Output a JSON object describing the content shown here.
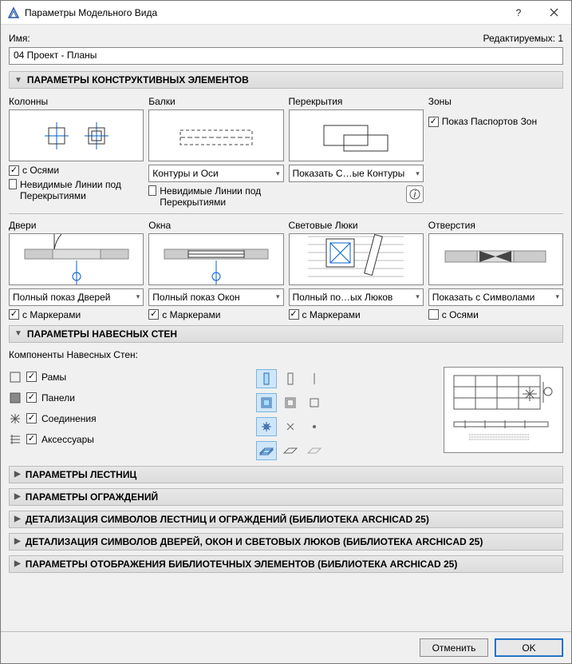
{
  "window": {
    "title": "Параметры Модельного Вида"
  },
  "header": {
    "name_label": "Имя:",
    "editable_label": "Редактируемых: 1",
    "name_value": "04 Проект - Планы"
  },
  "sections": {
    "construction": "ПАРАМЕТРЫ КОНСТРУКТИВНЫХ ЭЛЕМЕНТОВ",
    "curtain": "ПАРАМЕТРЫ НАВЕСНЫХ СТЕН",
    "stairs": "ПАРАМЕТРЫ ЛЕСТНИЦ",
    "railings": "ПАРАМЕТРЫ ОГРАЖДЕНИЙ",
    "detail_stairs": "ДЕТАЛИЗАЦИЯ СИМВОЛОВ ЛЕСТНИЦ И ОГРАЖДЕНИЙ (БИБЛИОТЕКА ARCHICAD 25)",
    "detail_doors": "ДЕТАЛИЗАЦИЯ СИМВОЛОВ ДВЕРЕЙ, ОКОН И СВЕТОВЫХ ЛЮКОВ (БИБЛИОТЕКА ARCHICAD 25)",
    "library": "ПАРАМЕТРЫ ОТОБРАЖЕНИЯ БИБЛИОТЕЧНЫХ ЭЛЕМЕНТОВ (БИБЛИОТЕКА ARCHICAD 25)"
  },
  "columns": {
    "label": "Колонны",
    "chk_axes": "с Осями",
    "chk_hidden": "Невидимые Линии под Перекрытиями"
  },
  "beams": {
    "label": "Балки",
    "select": "Контуры и Оси",
    "chk_hidden": "Невидимые Линии под Перекрытиями"
  },
  "slabs": {
    "label": "Перекрытия",
    "select": "Показать С…ые Контуры"
  },
  "zones": {
    "label": "Зоны",
    "chk": "Показ Паспортов Зон"
  },
  "doors": {
    "label": "Двери",
    "select": "Полный показ Дверей",
    "chk": "с Маркерами"
  },
  "windows": {
    "label": "Окна",
    "select": "Полный показ Окон",
    "chk": "с Маркерами"
  },
  "skylights": {
    "label": "Световые Люки",
    "select": "Полный по…ых Люков",
    "chk": "с Маркерами"
  },
  "openings": {
    "label": "Отверстия",
    "select": "Показать с Символами",
    "chk": "с Осями"
  },
  "curtain": {
    "components_label": "Компоненты Навесных Стен:",
    "frames": "Рамы",
    "panels": "Панели",
    "joints": "Соединения",
    "accessories": "Аксессуары"
  },
  "buttons": {
    "cancel": "Отменить",
    "ok": "OK"
  }
}
